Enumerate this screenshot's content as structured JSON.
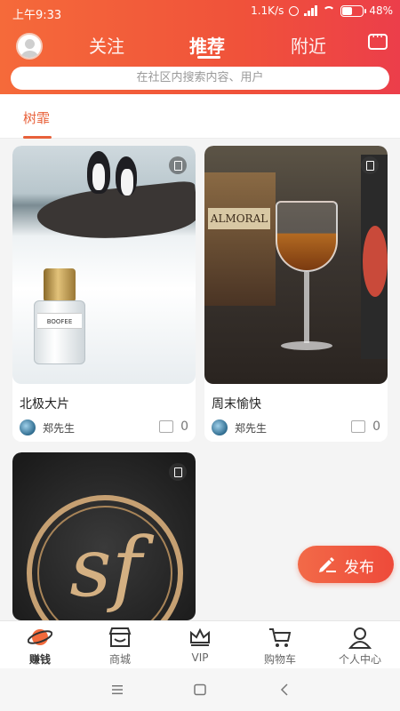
{
  "status": {
    "time": "上午9:33",
    "speed": "1.1K/s",
    "battery": "48%"
  },
  "header": {
    "tabs": [
      "关注",
      "推荐",
      "附近"
    ],
    "active_tab": "推荐",
    "search_placeholder": "在社区内搜索内容、用户"
  },
  "subtab": {
    "label": "树霏"
  },
  "cards": [
    {
      "title": "北极大片",
      "author": "郑先生",
      "likes": "0"
    },
    {
      "title": "周末愉快",
      "author": "郑先生",
      "likes": "0"
    },
    {
      "title": "",
      "author": "",
      "likes": ""
    }
  ],
  "images": {
    "whisky_label": "ALMORAL",
    "logo_mark": "sf",
    "bottle_label": "BOOFEE"
  },
  "publish": {
    "label": "发布"
  },
  "bottom_nav": [
    {
      "label": "赚钱",
      "icon": "planet-icon"
    },
    {
      "label": "商城",
      "icon": "store-icon"
    },
    {
      "label": "VIP",
      "icon": "crown-icon"
    },
    {
      "label": "购物车",
      "icon": "cart-icon"
    },
    {
      "label": "个人中心",
      "icon": "user-icon"
    }
  ],
  "colors": {
    "accent": "#f0523a",
    "active_subtab": "#e8613a"
  }
}
